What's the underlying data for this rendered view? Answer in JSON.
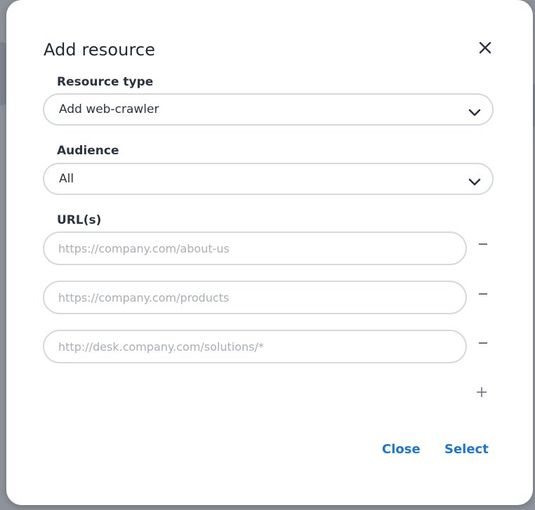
{
  "dialog": {
    "title": "Add resource"
  },
  "resource_type": {
    "label": "Resource type",
    "value": "Add web-crawler"
  },
  "audience": {
    "label": "Audience",
    "value": "All"
  },
  "urls": {
    "label": "URL(s)",
    "fields": [
      {
        "value": "",
        "placeholder": "https://company.com/about-us"
      },
      {
        "value": "",
        "placeholder": "https://company.com/products"
      },
      {
        "value": "",
        "placeholder": "http://desk.company.com/solutions/*"
      }
    ]
  },
  "footer": {
    "close_label": "Close",
    "select_label": "Select"
  },
  "colors": {
    "accent": "#1976d2",
    "text": "#2b3440",
    "border": "#d5d9de",
    "placeholder": "#a9afb6"
  },
  "icons": {
    "close": "close-icon",
    "chevron": "chevron-down-icon",
    "remove": "minus-icon",
    "add": "plus-icon"
  }
}
